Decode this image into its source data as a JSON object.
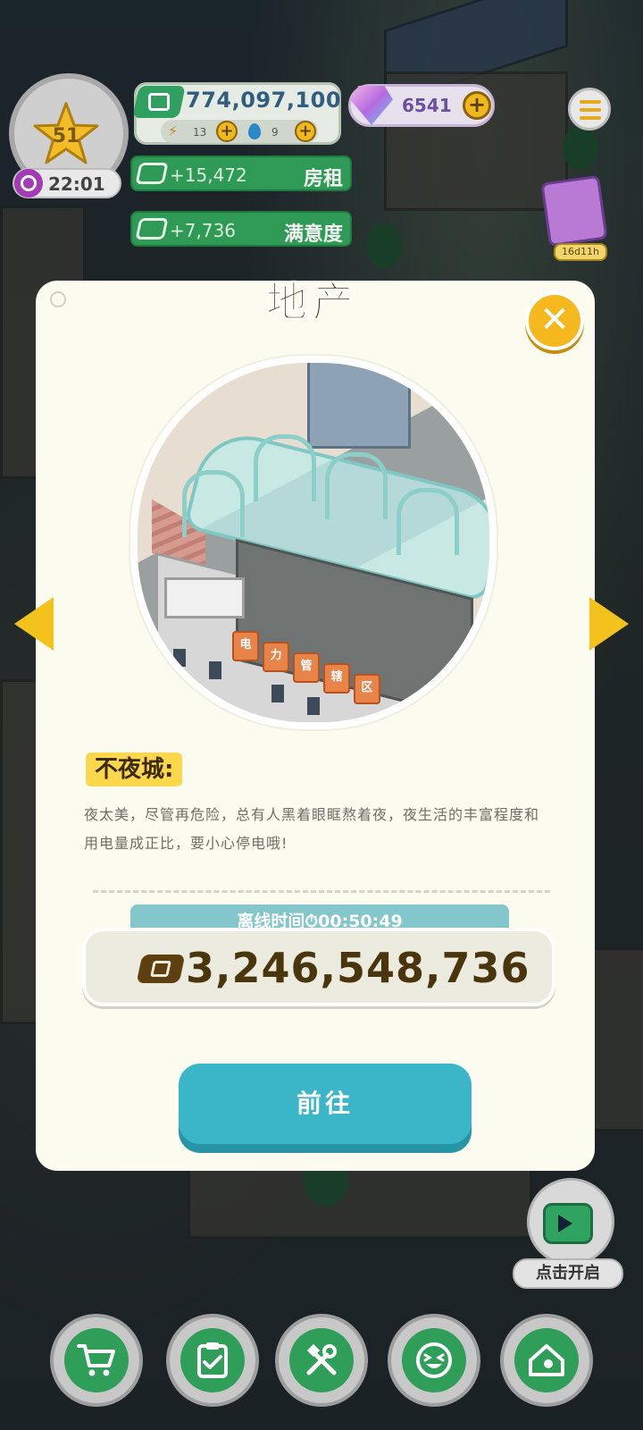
{
  "hud": {
    "level": "51",
    "timer": "22:01",
    "money": "774,097,100",
    "energy": "13",
    "water": "9",
    "gems": "6541",
    "income_rent": {
      "value": "+15,472",
      "label": "房租"
    },
    "income_satisfaction": {
      "value": "+7,736",
      "label": "满意度"
    },
    "event_badge": "16d11h"
  },
  "modal": {
    "title": "地产",
    "building_signs": [
      "电",
      "力",
      "管",
      "辖",
      "区"
    ],
    "tag": "不夜城:",
    "description": "夜太美，尽管再危险，总有人黑着眼眶熬着夜，夜生活的丰富程度和用电量成正比，要小心停电哦!",
    "offline_label": "离线时间",
    "offline_time": "00:50:49",
    "amount": "3,246,548,736",
    "go_button": "前往"
  },
  "ad": {
    "label": "点击开启"
  },
  "bottom_nav": [
    {
      "icon": "cart-icon"
    },
    {
      "icon": "clipboard-icon"
    },
    {
      "icon": "tools-icon"
    },
    {
      "icon": "laugh-icon"
    },
    {
      "icon": "home-icon"
    }
  ],
  "colors": {
    "accent_yellow": "#f4c21c",
    "green": "#2f9a55",
    "teal_button": "#3ab6c8",
    "modal_bg": "#fbfbef"
  }
}
